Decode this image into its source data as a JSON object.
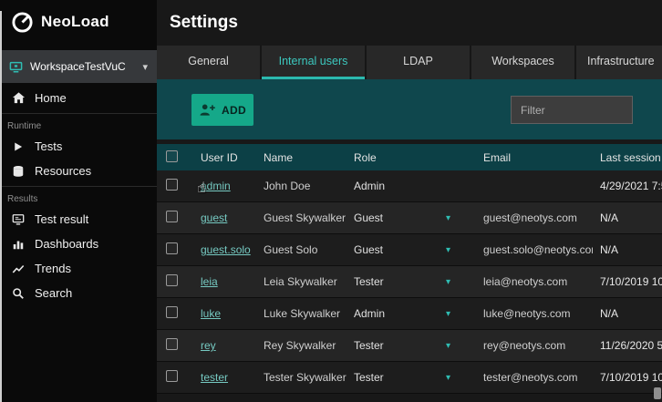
{
  "sidebar": {
    "logo_text": "NeoLoad",
    "workspace_label": "WorkspaceTestVuC",
    "sections": {
      "runtime": "Runtime",
      "results": "Results"
    },
    "items": {
      "home": "Home",
      "tests": "Tests",
      "resources": "Resources",
      "test_result": "Test result",
      "dashboards": "Dashboards",
      "trends": "Trends",
      "search": "Search"
    }
  },
  "header": {
    "title": "Settings"
  },
  "tabs": [
    {
      "label": "General",
      "active": false
    },
    {
      "label": "Internal users",
      "active": true
    },
    {
      "label": "LDAP",
      "active": false
    },
    {
      "label": "Workspaces",
      "active": false
    },
    {
      "label": "Infrastructure",
      "active": false
    }
  ],
  "toolbar": {
    "add_label": "ADD",
    "filter_placeholder": "Filter"
  },
  "table": {
    "columns": [
      "User ID",
      "Name",
      "Role",
      "Email",
      "Last session"
    ],
    "rows": [
      {
        "user_id": "admin",
        "name": "John Doe",
        "role": "Admin",
        "email": "",
        "last_session": "4/29/2021 7:5"
      },
      {
        "user_id": "guest",
        "name": "Guest Skywalker",
        "role": "Guest",
        "email": "guest@neotys.com",
        "last_session": "N/A"
      },
      {
        "user_id": "guest.solo",
        "name": "Guest Solo",
        "role": "Guest",
        "email": "guest.solo@neotys.com",
        "last_session": "N/A"
      },
      {
        "user_id": "leia",
        "name": "Leia Skywalker",
        "role": "Tester",
        "email": "leia@neotys.com",
        "last_session": "7/10/2019 10:"
      },
      {
        "user_id": "luke",
        "name": "Luke Skywalker",
        "role": "Admin",
        "email": "luke@neotys.com",
        "last_session": "N/A"
      },
      {
        "user_id": "rey",
        "name": "Rey Skywalker",
        "role": "Tester",
        "email": "rey@neotys.com",
        "last_session": "11/26/2020 5:"
      },
      {
        "user_id": "tester",
        "name": "Tester Skywalker",
        "role": "Tester",
        "email": "tester@neotys.com",
        "last_session": "7/10/2019 10:"
      }
    ]
  },
  "icons": {
    "chevron_down": "▾",
    "cursor_hand": "☝"
  },
  "colors": {
    "accent_teal": "#2fbdb3",
    "band_teal": "#0f474d",
    "add_button_green": "#15a889",
    "active_tab_text": "#3cc8be"
  }
}
